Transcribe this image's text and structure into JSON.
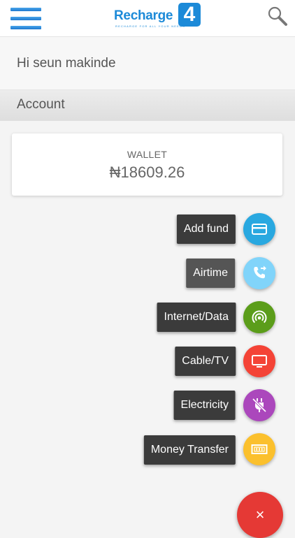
{
  "header": {
    "logo_text": "Recharge",
    "logo_number": "4",
    "logo_tagline": "RECHARGE FOR ALL YOUR NEEDS",
    "brand_color": "#1c8ad8",
    "menu_icon": "hamburger-menu-icon",
    "search_icon": "search-icon"
  },
  "greeting": "Hi seun makinde",
  "section_title": "Account",
  "wallet": {
    "label": "WALLET",
    "amount": "₦18609.26"
  },
  "actions": [
    {
      "label": "Add fund",
      "icon": "credit-card-icon",
      "color": "#29a8e0"
    },
    {
      "label": "Airtime",
      "icon": "phone-forward-icon",
      "color": "#81d4fa"
    },
    {
      "label": "Internet/Data",
      "icon": "wifi-signal-icon",
      "color": "#5b9d1a"
    },
    {
      "label": "Cable/TV",
      "icon": "tv-icon",
      "color": "#f44336"
    },
    {
      "label": "Electricity",
      "icon": "power-plug-off-icon",
      "color": "#ab47bc"
    },
    {
      "label": "Money Transfer",
      "icon": "cash-icon",
      "color": "#fbc02d"
    }
  ],
  "close_button": {
    "symbol": "×",
    "icon": "close-icon",
    "color": "#e53935"
  }
}
